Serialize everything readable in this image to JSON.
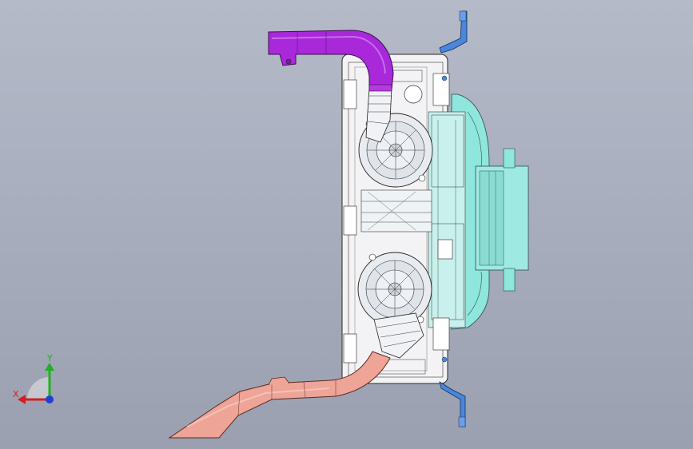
{
  "viewport": {
    "background_top": "#b4bac8",
    "background_bottom": "#9aa0b0"
  },
  "model": {
    "parts": [
      {
        "name": "upper-duct",
        "color": "#a524d8"
      },
      {
        "name": "lower-duct",
        "color": "#eda096"
      },
      {
        "name": "shroud-housing",
        "color": "#7fe0d8"
      },
      {
        "name": "frame-panel",
        "color": "#f2f2f4"
      },
      {
        "name": "fan-upper",
        "color": "#e6e8ee"
      },
      {
        "name": "fan-lower",
        "color": "#e6e8ee"
      },
      {
        "name": "mounting-brackets",
        "color": "#3f7fd8"
      }
    ]
  },
  "triad": {
    "x_label": "X",
    "y_label": "Y",
    "x_color": "#d02020",
    "y_color": "#20b020",
    "z_color": "#2040d0"
  }
}
